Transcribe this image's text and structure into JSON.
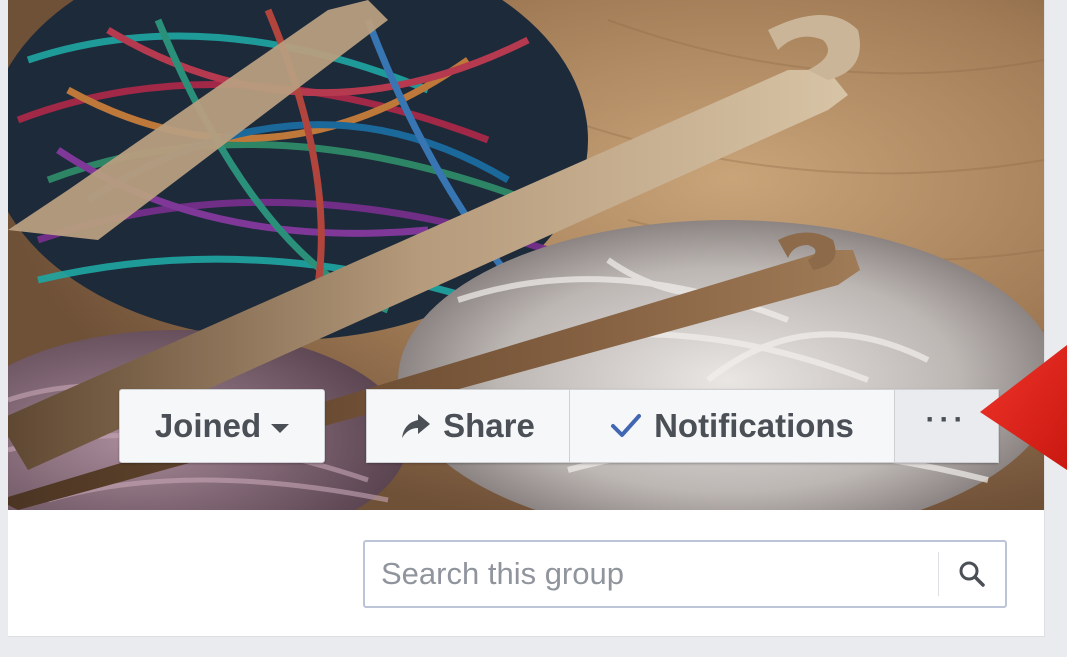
{
  "actions": {
    "joined_label": "Joined",
    "share_label": "Share",
    "notifications_label": "Notifications",
    "more_label": "···"
  },
  "search": {
    "placeholder": "Search this group",
    "value": ""
  },
  "icons": {
    "joined_caret": "chevron-down-icon",
    "share": "share-arrow-icon",
    "notifications_check": "checkmark-icon",
    "more": "more-dots-icon",
    "search": "search-icon",
    "callout": "red-arrow-pointer"
  },
  "colors": {
    "check_blue": "#4267b2",
    "arrow_red": "#e0231a",
    "button_text": "#4b4f56",
    "page_bg": "#e9ebee"
  }
}
